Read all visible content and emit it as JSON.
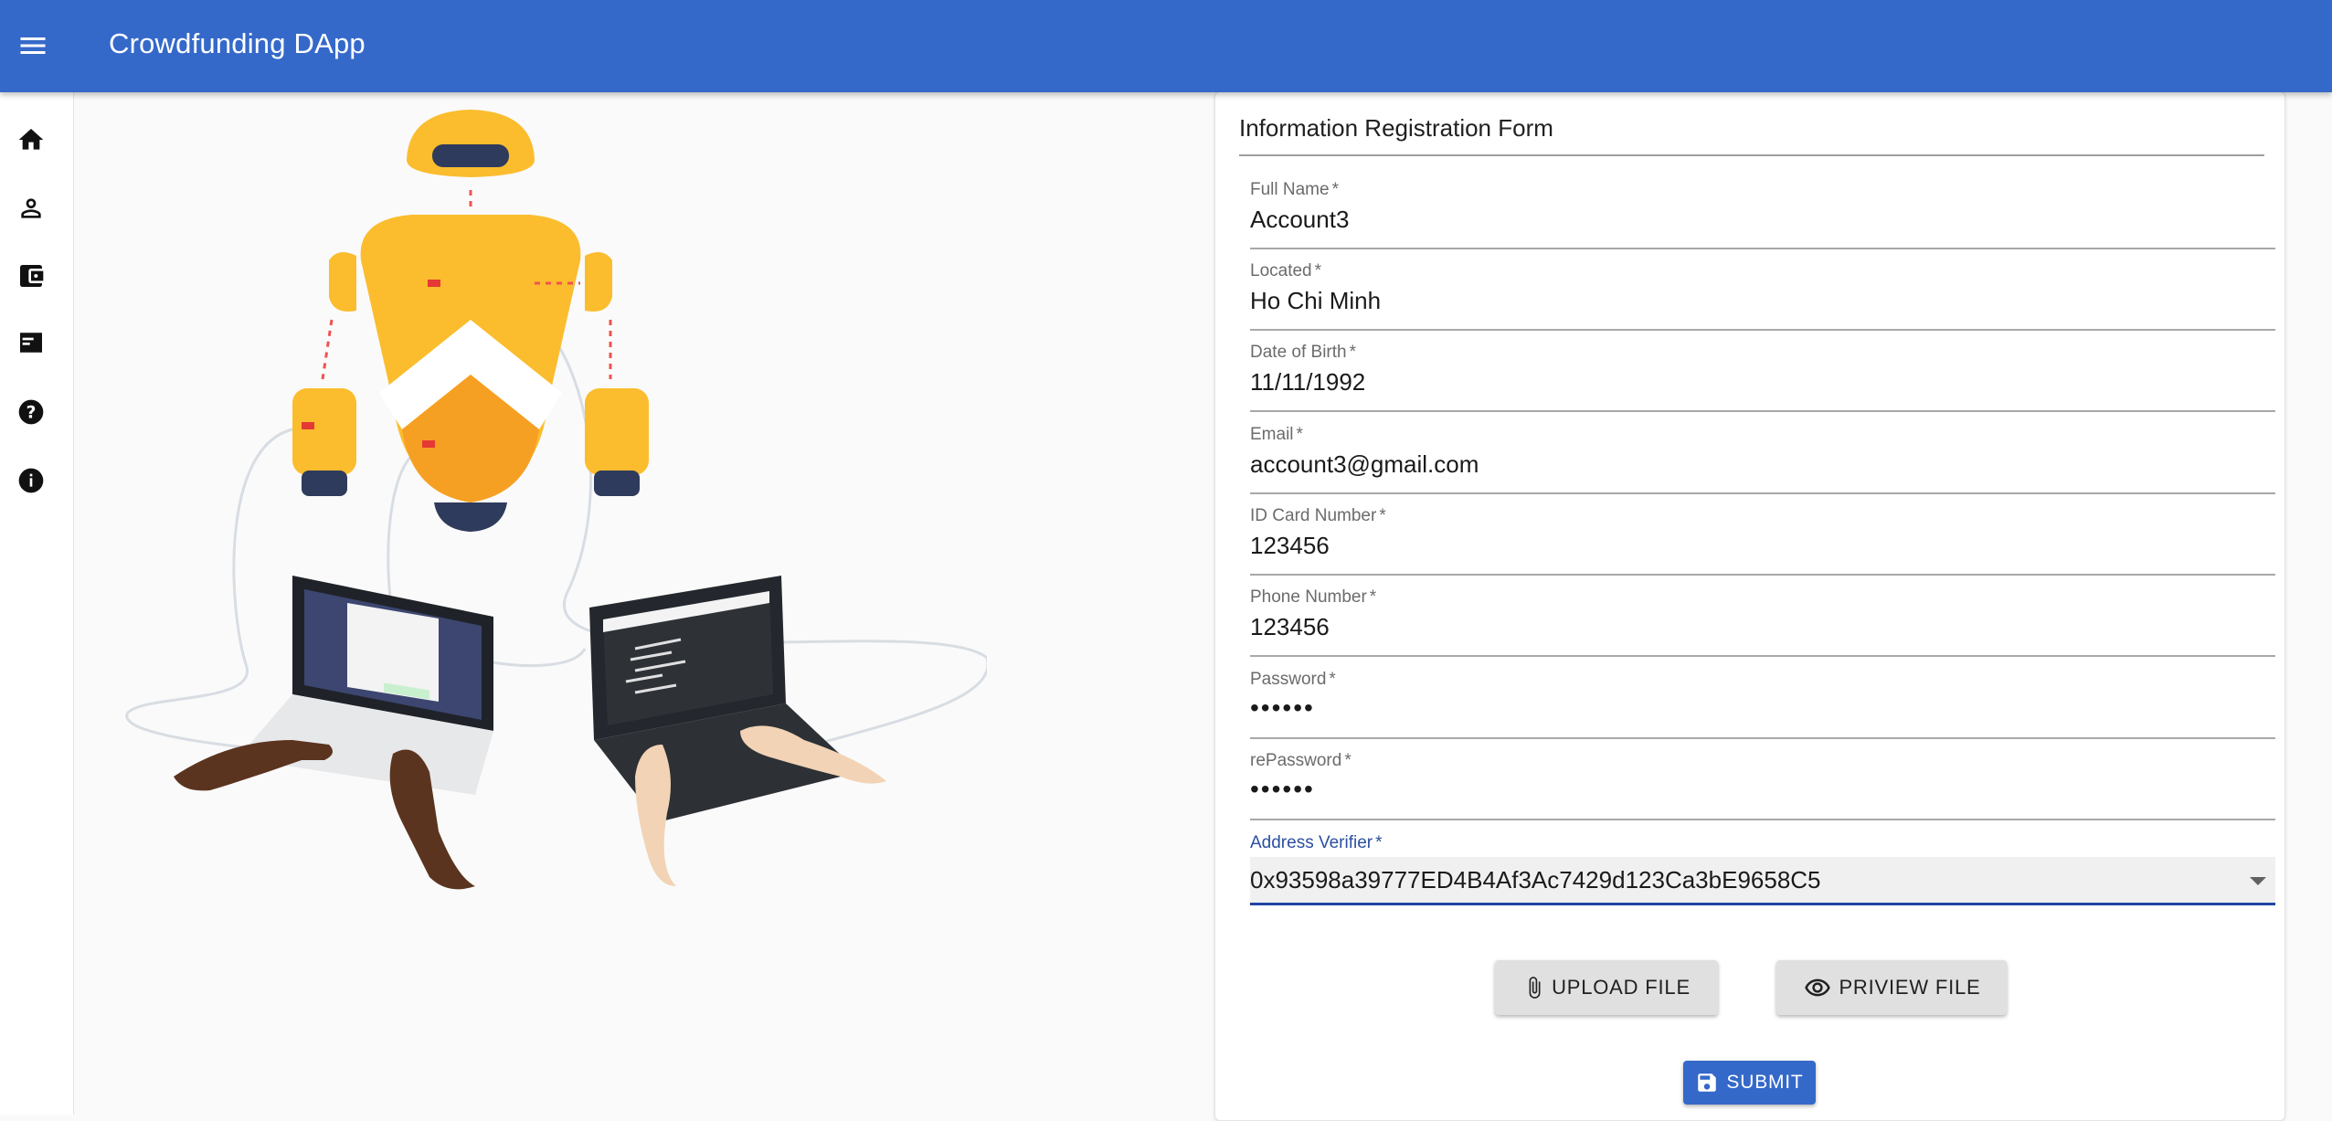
{
  "appbar": {
    "title": "Crowdfunding DApp",
    "color": "#3569c9"
  },
  "sidenav": {
    "items": [
      {
        "icon": "home-icon"
      },
      {
        "icon": "person-icon"
      },
      {
        "icon": "wallet-icon"
      },
      {
        "icon": "card-icon"
      },
      {
        "icon": "help-icon"
      },
      {
        "icon": "info-icon"
      }
    ]
  },
  "form": {
    "title": "Information Registration Form",
    "required_mark": "*",
    "fields": {
      "full_name": {
        "label": "Full Name",
        "value": "Account3"
      },
      "located": {
        "label": "Located",
        "value": "Ho Chi Minh"
      },
      "dob": {
        "label": "Date of Birth",
        "value": "11/11/1992"
      },
      "email": {
        "label": "Email",
        "value": "account3@gmail.com"
      },
      "id_card": {
        "label": "ID Card Number",
        "value": "123456"
      },
      "phone": {
        "label": "Phone Number",
        "value": "123456"
      },
      "password": {
        "label": "Password",
        "value": "••••••"
      },
      "repassword": {
        "label": "rePassword",
        "value": "••••••"
      },
      "address_verifier": {
        "label": "Address Verifier",
        "value": "0x93598a39777ED4B4Af3Ac7429d123Ca3bE9658C5"
      }
    },
    "buttons": {
      "upload": "UPLOAD FILE",
      "preview": "PRIVIEW FILE",
      "submit": "SUBMIT"
    }
  }
}
